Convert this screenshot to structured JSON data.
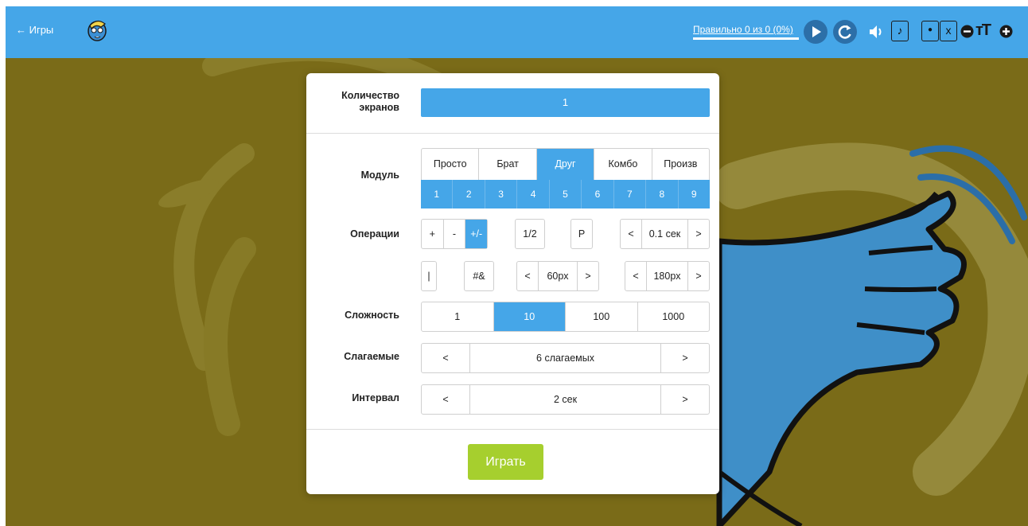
{
  "header": {
    "back_label": "← Игры",
    "score_text": "Правильно 0 из 0 (0%)",
    "note_label": "♪",
    "dot_label": "●",
    "x_label": "x",
    "font_size_label": "тТ"
  },
  "settings": {
    "screens": {
      "label": "Количество экранов",
      "value": "1"
    },
    "module": {
      "label": "Модуль",
      "tabs": [
        "Просто",
        "Брат",
        "Друг",
        "Комбо",
        "Произв"
      ],
      "active_tab": "Друг",
      "numbers": [
        "1",
        "2",
        "3",
        "4",
        "5",
        "6",
        "7",
        "8",
        "9"
      ]
    },
    "operations": {
      "label": "Операции",
      "signs": [
        "+",
        "-",
        "+/-"
      ],
      "active_sign": "+/-",
      "half": "1/2",
      "p": "Р",
      "prev": "<",
      "next": ">",
      "delay": "0.1 сек",
      "pipe": "|",
      "hash": "#&",
      "font_px": "60px",
      "width_px": "180px"
    },
    "difficulty": {
      "label": "Сложность",
      "options": [
        "1",
        "10",
        "100",
        "1000"
      ],
      "active": "10"
    },
    "addends": {
      "label": "Слагаемые",
      "value": "6 слагаемых",
      "prev": "<",
      "next": ">"
    },
    "interval": {
      "label": "Интервал",
      "value": "2 сек",
      "prev": "<",
      "next": ">"
    },
    "play_label": "Играть"
  },
  "colors": {
    "primary": "#45a6e8",
    "play": "#a6cf2e",
    "background": "#7a6b18"
  }
}
